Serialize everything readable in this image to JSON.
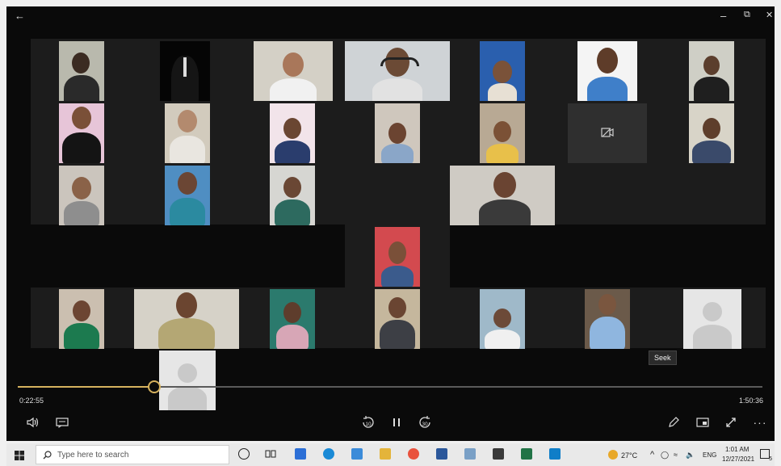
{
  "window": {
    "back_icon": "back-arrow-icon",
    "minimize_glyph": "–",
    "restore_glyph": "⧉",
    "close_glyph": "✕"
  },
  "player": {
    "seek_tooltip": "Seek",
    "current_time": "0:22:55",
    "total_time": "1:50:36",
    "progress_fraction": 0.183,
    "skip_back_label": "10",
    "skip_forward_label": "30"
  },
  "taskbar": {
    "search_placeholder": "Type here to search",
    "temperature": "27°C",
    "language": "ENG",
    "clock_time": "1:01 AM",
    "clock_date": "12/27/2021",
    "notification_count": "5"
  },
  "colors": {
    "accent": "#d6b25e",
    "window_bg": "#0a0a0a",
    "taskbar_bg": "#e9e9e9"
  }
}
